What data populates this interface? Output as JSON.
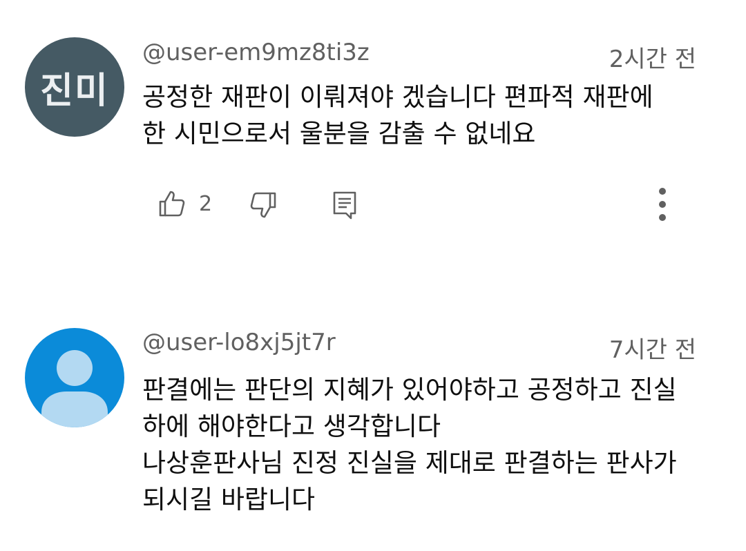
{
  "comments": [
    {
      "avatar": {
        "type": "initials",
        "initials": "진미",
        "bg_color": "#455a64"
      },
      "handle": "@user-em9mz8ti3z",
      "time": "2시간 전",
      "lines": [
        "공정한  재판이 이뤄져야 겠습니다 편파적 재판에",
        "한 시민으로서 울분을 감출 수 없네요"
      ],
      "like_count": "2",
      "actions": [
        "thumbs-up-icon",
        "thumbs-down-icon",
        "reply-icon",
        "more-vert-icon"
      ]
    },
    {
      "avatar": {
        "type": "default",
        "bg_color": "#0b8bd9"
      },
      "handle": "@user-lo8xj5jt7r",
      "time": "7시간 전",
      "lines": [
        "판결에는 판단의 지혜가 있어야하고 공정하고 진실",
        "하에 해야한다고 생각합니다",
        "나상훈판사님 진정 진실을 제대로 판결하는 판사가",
        "되시길 바랍니다"
      ]
    }
  ]
}
